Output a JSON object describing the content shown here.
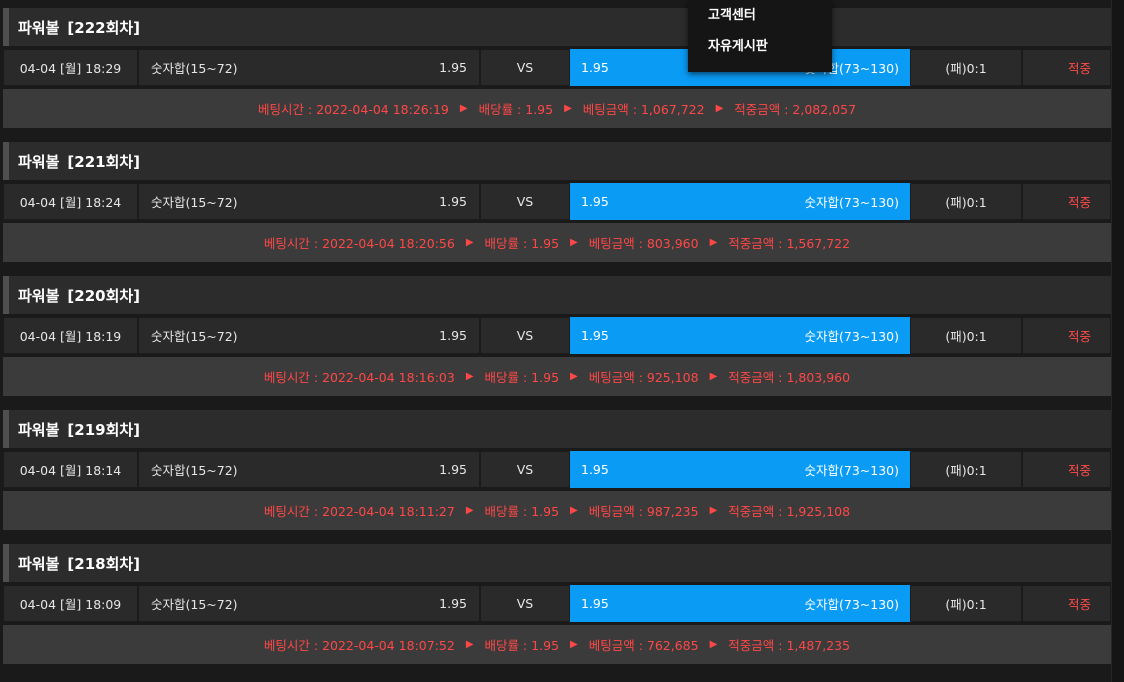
{
  "menu": {
    "items": [
      "고객센터",
      "자유게시판"
    ]
  },
  "rounds": [
    {
      "game": "파워볼",
      "round": "[222회차]",
      "date": "04-04 [월] 18:29",
      "home_team": "숫자합(15~72)",
      "home_odds": "1.95",
      "vs": "VS",
      "away_odds": "1.95",
      "away_team": "숫자합(73~130)",
      "score": "(패)0:1",
      "result": "적중",
      "bet_time": "베팅시간 : 2022-04-04 18:26:19",
      "odds_text": "배당률 : 1.95",
      "bet_amount": "베팅금액 : 1,067,722",
      "win_amount": "적중금액 : 2,082,057"
    },
    {
      "game": "파워볼",
      "round": "[221회차]",
      "date": "04-04 [월] 18:24",
      "home_team": "숫자합(15~72)",
      "home_odds": "1.95",
      "vs": "VS",
      "away_odds": "1.95",
      "away_team": "숫자합(73~130)",
      "score": "(패)0:1",
      "result": "적중",
      "bet_time": "베팅시간 : 2022-04-04 18:20:56",
      "odds_text": "배당률 : 1.95",
      "bet_amount": "베팅금액 : 803,960",
      "win_amount": "적중금액 : 1,567,722"
    },
    {
      "game": "파워볼",
      "round": "[220회차]",
      "date": "04-04 [월] 18:19",
      "home_team": "숫자합(15~72)",
      "home_odds": "1.95",
      "vs": "VS",
      "away_odds": "1.95",
      "away_team": "숫자합(73~130)",
      "score": "(패)0:1",
      "result": "적중",
      "bet_time": "베팅시간 : 2022-04-04 18:16:03",
      "odds_text": "배당률 : 1.95",
      "bet_amount": "베팅금액 : 925,108",
      "win_amount": "적중금액 : 1,803,960"
    },
    {
      "game": "파워볼",
      "round": "[219회차]",
      "date": "04-04 [월] 18:14",
      "home_team": "숫자합(15~72)",
      "home_odds": "1.95",
      "vs": "VS",
      "away_odds": "1.95",
      "away_team": "숫자합(73~130)",
      "score": "(패)0:1",
      "result": "적중",
      "bet_time": "베팅시간 : 2022-04-04 18:11:27",
      "odds_text": "배당률 : 1.95",
      "bet_amount": "베팅금액 : 987,235",
      "win_amount": "적중금액 : 1,925,108"
    },
    {
      "game": "파워볼",
      "round": "[218회차]",
      "date": "04-04 [월] 18:09",
      "home_team": "숫자합(15~72)",
      "home_odds": "1.95",
      "vs": "VS",
      "away_odds": "1.95",
      "away_team": "숫자합(73~130)",
      "score": "(패)0:1",
      "result": "적중",
      "bet_time": "베팅시간 : 2022-04-04 18:07:52",
      "odds_text": "배당률 : 1.95",
      "bet_amount": "베팅금액 : 762,685",
      "win_amount": "적중금액 : 1,487,235"
    }
  ],
  "colors": {
    "selected_pick": "#0a9cf5",
    "result_text": "#ff4b4b",
    "detail_text": "#ff4747"
  },
  "icons": {
    "detail_separator": "triangle-right-icon"
  }
}
